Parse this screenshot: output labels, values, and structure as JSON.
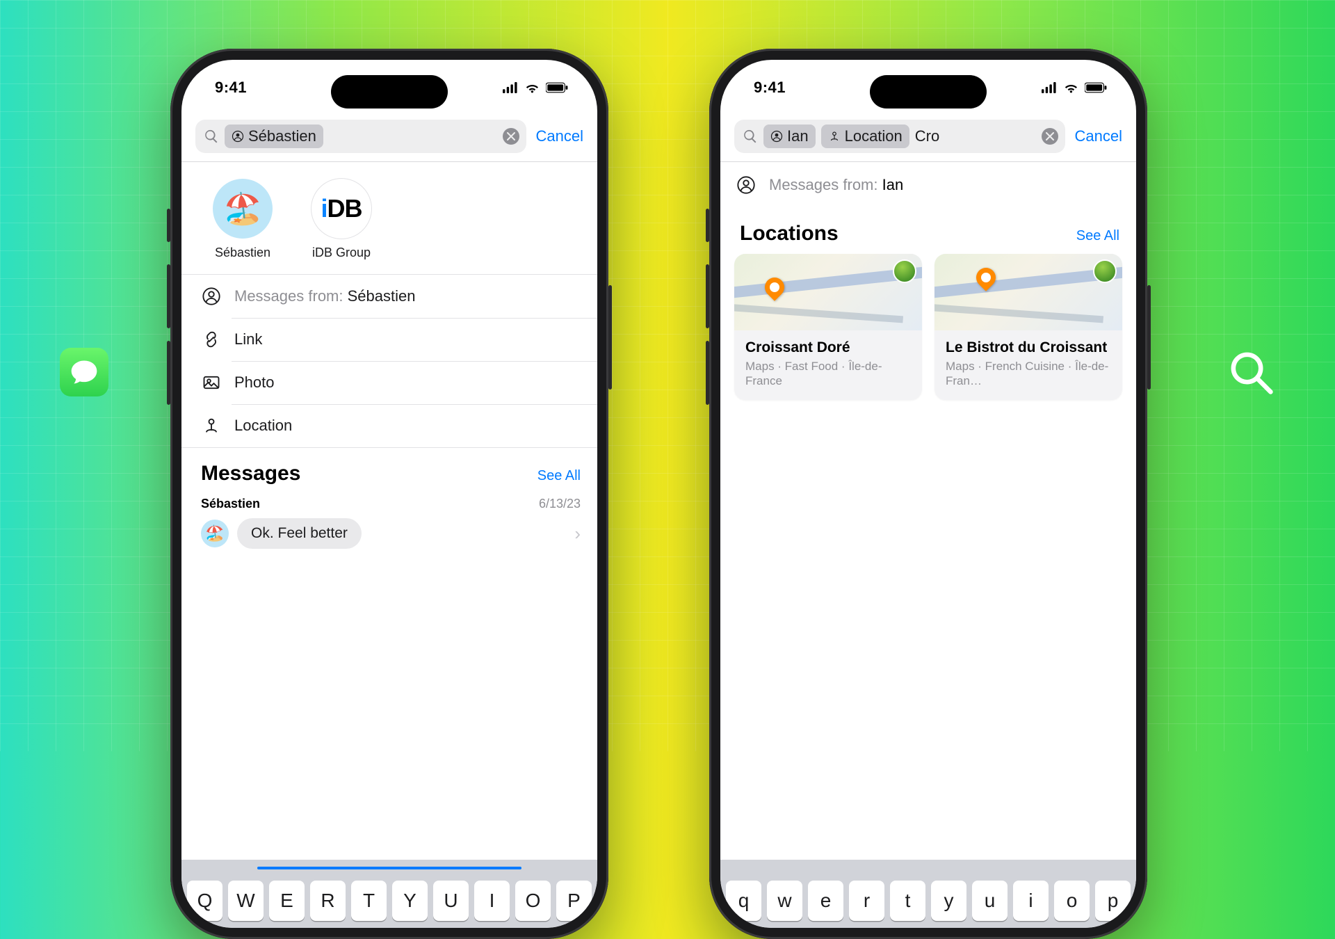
{
  "decor": {
    "messages_app_icon": "messages-app",
    "search_icon": "search"
  },
  "status": {
    "time": "9:41"
  },
  "phone1": {
    "search": {
      "token_person": "Sébastien",
      "cancel": "Cancel"
    },
    "contacts": [
      {
        "name": "Sébastien",
        "avatar_emoji": "🏖️"
      },
      {
        "name": "iDB Group",
        "avatar_text_i": "i",
        "avatar_text_db": "DB"
      }
    ],
    "filters": {
      "messages_from_label": "Messages from:",
      "messages_from_value": "Sébastien",
      "link": "Link",
      "photo": "Photo",
      "location": "Location"
    },
    "messages_section": {
      "title": "Messages",
      "see_all": "See All",
      "rows": [
        {
          "sender": "Sébastien",
          "date": "6/13/23",
          "text": "Ok. Feel better",
          "avatar_emoji": "🏖️"
        }
      ]
    },
    "keyboard_row": [
      "Q",
      "W",
      "E",
      "R",
      "T",
      "Y",
      "U",
      "I",
      "O",
      "P"
    ]
  },
  "phone2": {
    "search": {
      "token_person": "Ian",
      "token_location": "Location",
      "query": "Cro",
      "cancel": "Cancel"
    },
    "from_row": {
      "label": "Messages from:",
      "value": "Ian"
    },
    "locations_section": {
      "title": "Locations",
      "see_all": "See All",
      "cards": [
        {
          "title": "Croissant Doré",
          "sub": "Maps · Fast Food · Île-de-France"
        },
        {
          "title": "Le Bistrot du Croissant",
          "sub": "Maps · French Cuisine · Île-de-Fran…"
        }
      ]
    },
    "keyboard_row": [
      "q",
      "w",
      "e",
      "r",
      "t",
      "y",
      "u",
      "i",
      "o",
      "p"
    ]
  }
}
